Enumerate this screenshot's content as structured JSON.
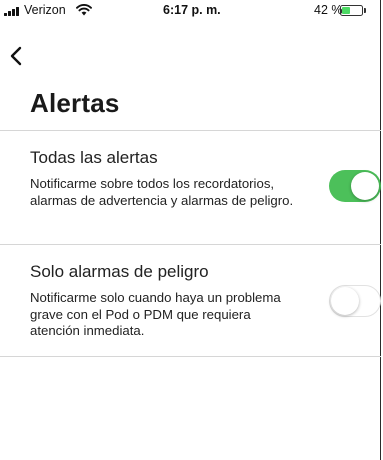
{
  "status_bar": {
    "carrier": "Verizon",
    "time": "6:17 p. m.",
    "battery_percent": "42 %",
    "battery_level": 0.42,
    "icons": [
      "signal-icon",
      "wifi-icon",
      "battery-icon"
    ]
  },
  "nav": {
    "back_icon": "chevron-left-icon"
  },
  "page": {
    "title": "Alertas"
  },
  "settings": [
    {
      "title": "Todas las alertas",
      "description": "Notificarme sobre todos los recordatorios, alarmas de advertencia y alarmas de peligro.",
      "enabled": true
    },
    {
      "title": "Solo alarmas de peligro",
      "description": "Notificarme solo cuando haya un problema grave con el Pod o PDM que requiera atención inmediata.",
      "enabled": false
    }
  ],
  "colors": {
    "toggle_on": "#4cc05a",
    "battery": "#4cd964",
    "divider": "#d6d6d6"
  }
}
